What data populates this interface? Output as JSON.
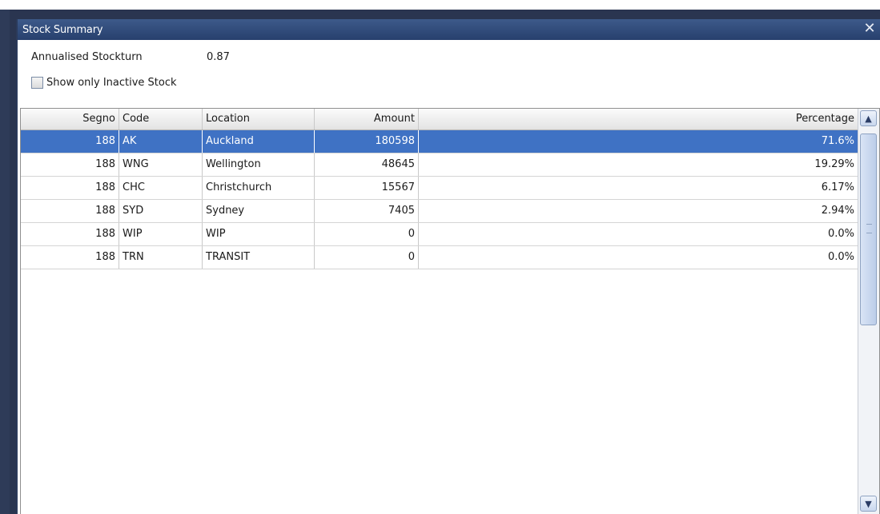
{
  "window": {
    "title": "Stock Summary",
    "close_glyph": "✕"
  },
  "summary": {
    "stockturn_label": "Annualised Stockturn",
    "stockturn_value": "0.87",
    "inactive_checkbox_label": "Show only Inactive Stock",
    "inactive_checked": false
  },
  "table": {
    "columns": [
      "Segno",
      "Code",
      "Location",
      "Amount",
      "Percentage"
    ],
    "rows": [
      {
        "segno": "188",
        "code": "AK",
        "location": "Auckland",
        "amount": "180598",
        "percentage": "71.6%"
      },
      {
        "segno": "188",
        "code": "WNG",
        "location": "Wellington",
        "amount": "48645",
        "percentage": "19.29%"
      },
      {
        "segno": "188",
        "code": "CHC",
        "location": "Christchurch",
        "amount": "15567",
        "percentage": "6.17%"
      },
      {
        "segno": "188",
        "code": "SYD",
        "location": "Sydney",
        "amount": "7405",
        "percentage": "2.94%"
      },
      {
        "segno": "188",
        "code": "WIP",
        "location": "WIP",
        "amount": "0",
        "percentage": "0.0%"
      },
      {
        "segno": "188",
        "code": "TRN",
        "location": "TRANSIT",
        "amount": "0",
        "percentage": "0.0%"
      }
    ],
    "selected_row": 0
  },
  "scrollbar": {
    "up_glyph": "▲",
    "down_glyph": "▼"
  },
  "colors": {
    "titlebar": "#2f4a7a",
    "selection": "#3f72c4"
  }
}
